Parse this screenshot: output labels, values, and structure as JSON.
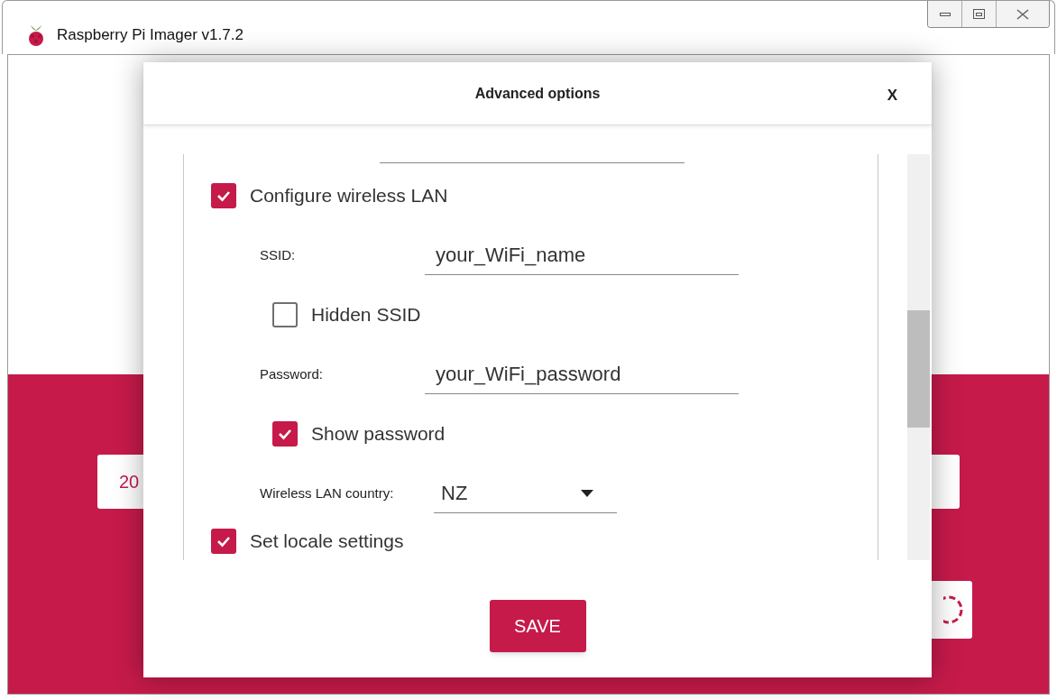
{
  "window": {
    "title": "Raspberry Pi Imager v1.7.2"
  },
  "background": {
    "button_label": "20"
  },
  "dialog": {
    "title": "Advanced options",
    "close": "X",
    "save": "SAVE",
    "items": [
      {
        "kind": "checkbox",
        "label": "Configure wireless LAN",
        "checked": true,
        "indent": false
      },
      {
        "kind": "text_field",
        "label": "SSID:",
        "value": "your_WiFi_name"
      },
      {
        "kind": "checkbox",
        "label": "Hidden SSID",
        "checked": false,
        "indent": true
      },
      {
        "kind": "text_field",
        "label": "Password:",
        "value": "your_WiFi_password"
      },
      {
        "kind": "checkbox",
        "label": "Show password",
        "checked": true,
        "indent": true
      },
      {
        "kind": "select",
        "label": "Wireless LAN country:",
        "value": "NZ"
      },
      {
        "kind": "checkbox",
        "label": "Set locale settings",
        "checked": true,
        "indent": false
      }
    ]
  }
}
